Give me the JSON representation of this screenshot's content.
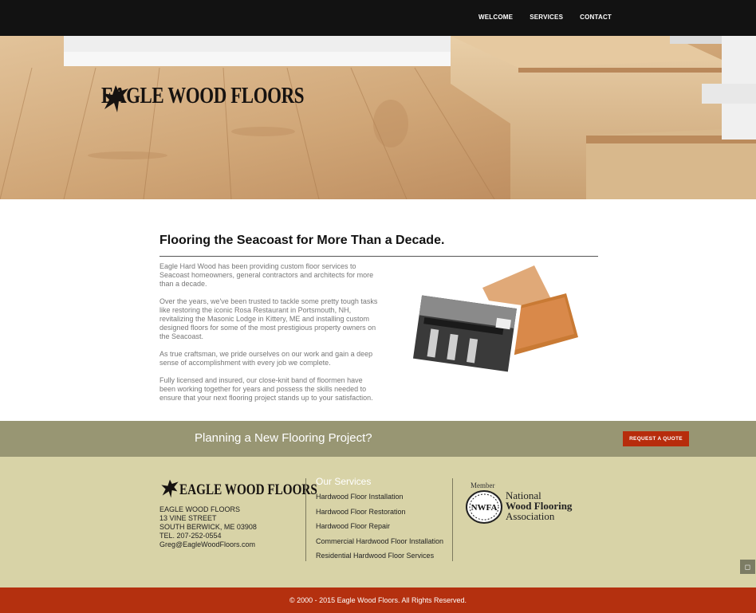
{
  "nav": {
    "items": [
      "WELCOME",
      "SERVICES",
      "CONTACT"
    ]
  },
  "brand": {
    "name": "EAGLE WOOD FLOORS",
    "logo_icon": "eagle-icon"
  },
  "main": {
    "headline": "Flooring the Seacoast for More Than a Decade.",
    "paragraphs": [
      "Eagle Hard Wood has been providing custom floor services to Seacoast homeowners, general contractors and architects for more than a decade.",
      "Over the years, we've been trusted to tackle some pretty tough tasks like restoring the iconic Rosa Restaurant in Portsmouth, NH, revitalizing the Masonic Lodge in Kittery, ME and installing custom designed floors for some of the most prestigious property owners on the Seacoast.",
      "As true craftsman, we pride ourselves on our work and gain a deep sense of accomplishment with every job we complete.",
      "Fully licensed and insured, our close-knit band of floormen have been working together for years and possess the skills needed to ensure that your next flooring project stands up to your satisfaction."
    ]
  },
  "cta": {
    "text": "Planning a New Flooring Project?",
    "button": "REQUEST A QUOTE"
  },
  "footer": {
    "brand": "EAGLE WOOD FLOORS",
    "address": [
      "EAGLE WOOD FLOORS",
      "13 VINE STREET",
      "SOUTH BERWICK, ME 03908",
      "TEL. 207-252-0554",
      "Greg@EagleWoodFloors.com"
    ],
    "services_title": "Our Services",
    "services": [
      "Hardwood Floor Installation",
      "Hardwood Floor Restoration",
      "Hardwood Floor Repair",
      "Commercial Hardwood Floor Installation",
      "Residential Hardwood Floor Services"
    ],
    "nwfa": {
      "member": "Member",
      "seal": "NWFA",
      "line1": "National",
      "line2": "Wood Flooring",
      "line3": "Association"
    },
    "scroll_icon": "scroll-top-icon"
  },
  "copyright": "© 2000 - 2015 Eagle Wood Floors. All Rights Reserved.",
  "colors": {
    "topbar": "#121212",
    "cta_band": "#989673",
    "button": "#b72c0c",
    "footer": "#d8d3a7",
    "copyright_bar": "#b4300f"
  }
}
